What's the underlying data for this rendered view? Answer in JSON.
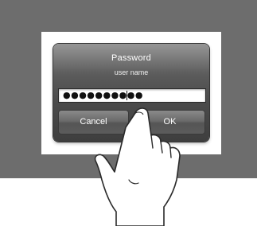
{
  "dialog": {
    "title": "Password",
    "subtitle": "user name",
    "password_mask": "●●●●●●●●●●",
    "cancel_label": "Cancel",
    "ok_label": "OK"
  },
  "colors": {
    "backdrop": "#6d6d6d",
    "dialog_top": "#7e7e7e",
    "dialog_bottom": "#3e3e3e"
  },
  "icons": {
    "hand": "pointing-hand-icon"
  }
}
